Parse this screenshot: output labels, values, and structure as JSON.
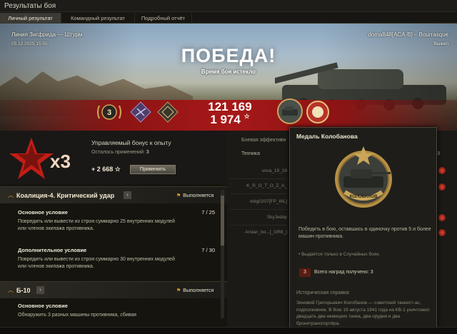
{
  "window": {
    "title": "Результаты боя"
  },
  "tabs": [
    {
      "label": "Личный результат"
    },
    {
      "label": "Командный результат"
    },
    {
      "label": "Подробный отчёт"
    }
  ],
  "banner": {
    "map": "Линия Зигфрида — Штурм",
    "date": "05.12.2025 15:55",
    "player": "doma848[ACA-B] – Bourrasque",
    "status_right": "Выжил",
    "result": "ПОБЕДА!",
    "result_sub": "Время боя истекло",
    "rank": "3",
    "credits": "121 169",
    "xp": "1 974"
  },
  "bonus": {
    "multiplier": "x3",
    "title": "Управляемый бонус к опыту",
    "remaining_label": "Осталось применений:",
    "remaining_value": "3",
    "xp": "+ 2 668 ☆",
    "apply_label": "Применить"
  },
  "missions": [
    {
      "title": "Коалиция-4. Критический удар",
      "status": "Выполняется",
      "conditions": [
        {
          "title": "Основное условие",
          "count": "7 / 25",
          "text": "Повредить или вывести из строя суммарно 25 внутренних модулей или членов экипажа противника."
        },
        {
          "title": "Дополнительное условие",
          "count": "7 / 30",
          "text": "Повредить или вывести из строя суммарно 30 внутренних модулей или членов экипажа противника."
        }
      ]
    },
    {
      "title": "Б-10",
      "status": "Выполняется",
      "conditions": [
        {
          "title": "Основное условие",
          "count": "",
          "text": "Обнаружить 3 разных машины противника, сбивая"
        }
      ]
    }
  ],
  "right_panel": {
    "header": "Боевая эффективн",
    "column": "Техника",
    "count_visible": "3",
    "rows": [
      "vova_19_19",
      "K_R_O_T_O_Z_A_",
      "dolg0207[FP_WL]",
      "SkyJeday",
      "Arslan_bo...[_GR8_]"
    ]
  },
  "tooltip": {
    "title": "Медаль Колобанова",
    "medal_text": "КОЛОБАНОВ",
    "description": "Победить в бою, оставшись в одиночку против 5 и более машин противника.",
    "note": "• Выдаётся только в Случайных боях.",
    "count_badge": "3",
    "count_label": "Всего наград получено: 3",
    "history_title": "Историческая справка:",
    "history": "Зиновий Григорьевич Колобанов — советский танкист-ас, подполковник. В бою 19 августа 1941 года на КВ-1 уничтожил двадцать два немецких танка, два орудия и два бронетранспортёра."
  },
  "colors": {
    "accent_orange": "#e89a2a",
    "victory_red": "#a71818"
  }
}
